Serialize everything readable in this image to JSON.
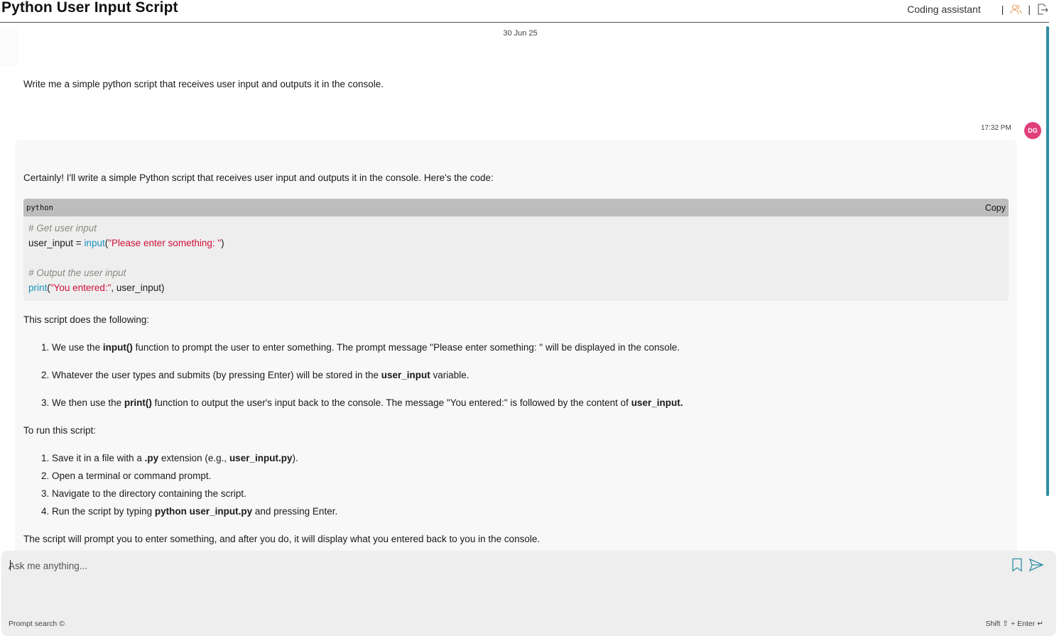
{
  "header": {
    "title": "Python User Input Script",
    "assistant_label": "Coding assistant",
    "separator": "|"
  },
  "chat": {
    "date": "30 Jun 25",
    "user_message": "Write me a simple python script that receives user input and outputs it in the console.",
    "timestamp": "17:32 PM",
    "avatar_initials": "DG",
    "bot": {
      "intro": "Certainly! I'll write a simple Python script that receives user input and outputs it in the console. Here's the code:",
      "code": {
        "language": "python",
        "copy_label": "Copy",
        "comment1": "# Get user input",
        "line2_var": "user_input = ",
        "line2_fn": "input",
        "line2_open": "(",
        "line2_str": "\"Please enter something: \"",
        "line2_close": ")",
        "comment2": "# Output the user input",
        "line5_fn": "print",
        "line5_open": "(",
        "line5_str": "\"You entered:\"",
        "line5_rest": ", user_input)"
      },
      "does_following": "This script does the following:",
      "steps": [
        {
          "n": "1.",
          "a": "We use the ",
          "b": "input()",
          "c": " function to prompt the user to enter something. The prompt message \"Please enter something: \" will be displayed in the console.",
          "d": "",
          "e": ""
        },
        {
          "n": "2.",
          "a": "Whatever the user types and submits (by pressing Enter) will be stored in the ",
          "b": "user_input",
          "c": " variable.",
          "d": "",
          "e": ""
        },
        {
          "n": "3.",
          "a": "We then use the ",
          "b": "print()",
          "c": " function to output the user's input back to the console. The message \"You entered:\" is followed by the content of ",
          "d": "user_input",
          "e": "."
        }
      ],
      "run_heading": "To run this script:",
      "run_steps": [
        {
          "n": "1.",
          "a": "Save it in a file with a ",
          "b": ".py",
          "c": " extension (e.g., ",
          "d": "user_input.py",
          "e": ")."
        },
        {
          "n": "2.",
          "a": "Open a terminal or command prompt.",
          "b": "",
          "c": "",
          "d": "",
          "e": ""
        },
        {
          "n": "3.",
          "a": "Navigate to the directory containing the script.",
          "b": "",
          "c": "",
          "d": "",
          "e": ""
        },
        {
          "n": "4.",
          "a": "Run the script by typing ",
          "b": "python user_input.py",
          "c": " and pressing Enter.",
          "d": "",
          "e": ""
        }
      ],
      "closing": "The script will prompt you to enter something, and after you do, it will display what you entered back to you in the console."
    }
  },
  "composer": {
    "placeholder": "Ask me anything...",
    "prompt_search": "Prompt search ©",
    "shift_hint": "Shift ⇧ + Enter ↵"
  },
  "colors": {
    "accent": "#2f8fa3",
    "avatar": "#e0407a",
    "code_fn": "#1a8fbf",
    "code_str": "#d0103a",
    "user_icon": "#e8a060"
  },
  "icons": [
    "user-icon",
    "logout-icon",
    "bookmark-icon",
    "send-icon"
  ]
}
